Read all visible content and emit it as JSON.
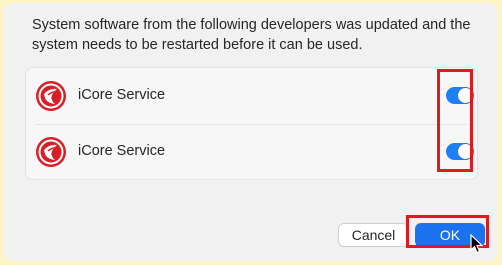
{
  "dialog": {
    "message": "System software from the following developers was updated and the system needs to be restarted before it can be used."
  },
  "list": {
    "items": [
      {
        "name": "iCore Service",
        "icon": "icore-app-icon",
        "enabled": true
      },
      {
        "name": "iCore Service",
        "icon": "icore-app-icon",
        "enabled": true
      }
    ]
  },
  "buttons": {
    "cancel_label": "Cancel",
    "ok_label": "OK"
  },
  "colors": {
    "accent": "#1f7ff6",
    "highlight": "#e0191f",
    "app_icon_red": "#d61f26"
  }
}
